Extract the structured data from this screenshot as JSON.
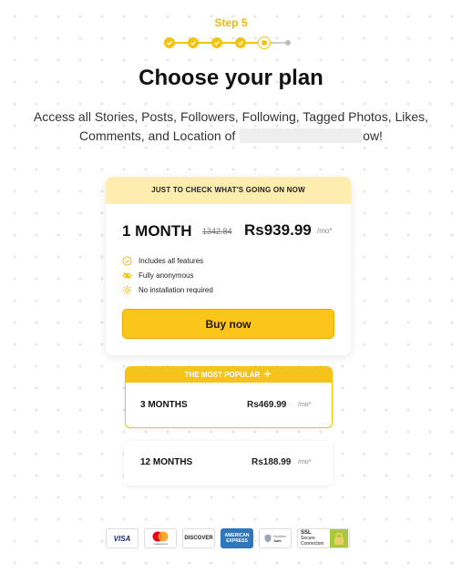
{
  "step_label": "Step 5",
  "stepper": {
    "completed": 4,
    "current": 5,
    "total": 6
  },
  "title": "Choose your plan",
  "subtitle": {
    "before": "Access all Stories, Posts, Followers, Following, Tagged Photos, Likes, Comments, and Location of",
    "after": "ow!"
  },
  "plan_card": {
    "banner": "JUST TO CHECK WHAT'S GOING ON NOW",
    "name": "1 MONTH",
    "old_price": "1342.84",
    "price": "Rs939.99",
    "per": "/mo*",
    "features": [
      {
        "icon": "check-circle-icon",
        "label": "Includes all features"
      },
      {
        "icon": "eye-off-icon",
        "label": "Fully anonymous"
      },
      {
        "icon": "gear-icon",
        "label": "No installation required"
      }
    ],
    "button": "Buy now"
  },
  "options": [
    {
      "badge": "THE MOST POPULAR",
      "name": "3 MONTHS",
      "price": "Rs469.99",
      "per": "/mo*"
    },
    {
      "name": "12 MONTHS",
      "price": "Rs188.99",
      "per": "/mo*"
    }
  ],
  "payments": {
    "visa": "VISA",
    "mastercard_text": "mastercard",
    "discover": "DISCOVER",
    "amex_line1": "AMERICAN",
    "amex_line2": "EXPRESS",
    "mcafee_line1": "McAfee",
    "mcafee_line2": "Safe",
    "ssl_line1": "SSL",
    "ssl_line2": "Secure",
    "ssl_line3": "Connection"
  },
  "colors": {
    "accent": "#f5c30f",
    "banner_bg": "#fdeeb0",
    "button": "#fbc51a"
  }
}
